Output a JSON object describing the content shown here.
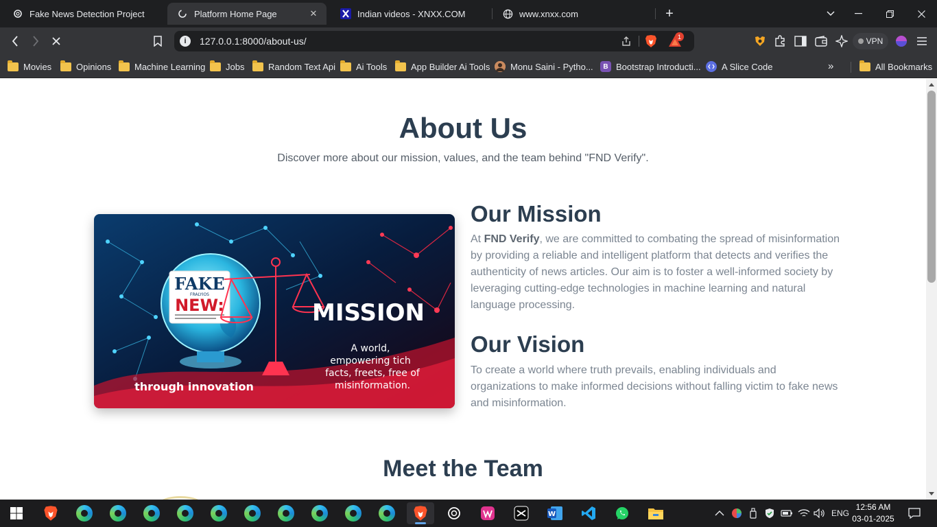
{
  "browser": {
    "tabs": [
      {
        "title": "Fake News Detection Project",
        "icon": "chatgpt-icon",
        "active": false
      },
      {
        "title": "Platform Home Page",
        "icon": "loading-icon",
        "active": true
      },
      {
        "title": "Indian videos - XNXX.COM",
        "icon": "x-site-icon",
        "active": false
      },
      {
        "title": "www.xnxx.com",
        "icon": "globe-icon",
        "active": false
      }
    ],
    "new_tab": "+",
    "url": "127.0.0.1:8000/about-us/",
    "rewards_count": "1",
    "vpn_label": "VPN"
  },
  "bookmarks": {
    "items": [
      {
        "label": "Movies",
        "type": "folder"
      },
      {
        "label": "Opinions",
        "type": "folder"
      },
      {
        "label": "Machine Learning",
        "type": "folder"
      },
      {
        "label": "Jobs",
        "type": "folder"
      },
      {
        "label": "Random Text Api",
        "type": "folder"
      },
      {
        "label": "Ai Tools",
        "type": "folder"
      },
      {
        "label": "App Builder Ai Tools",
        "type": "folder"
      },
      {
        "label": "Monu Saini - Pytho...",
        "type": "link",
        "icon": "avatar-icon"
      },
      {
        "label": "Bootstrap Introducti...",
        "type": "link",
        "icon": "bootstrap-icon",
        "icon_text": "B"
      },
      {
        "label": "A Slice Code",
        "type": "link",
        "icon": "code-icon"
      }
    ],
    "more": "»",
    "all_bookmarks": "All Bookmarks"
  },
  "page": {
    "title": "About Us",
    "subtitle": "Discover more about our mission, values, and the team behind \"FND Verify\".",
    "mission_image": {
      "fake_text": "FAKE",
      "small_text": "FRALYIOS",
      "new_text": "NEW:",
      "mission_text": "MISSION",
      "tagline_lines": [
        "A world,",
        "empowering tich",
        "facts, freets, free of",
        "misinformation."
      ],
      "bottom_text": "through innovation"
    },
    "mission": {
      "heading": "Our Mission",
      "lead": "At ",
      "brand": "FND Verify",
      "body": ", we are committed to combating the spread of misinformation by providing a reliable and intelligent platform that detects and verifies the authenticity of news articles. Our aim is to foster a well-informed society by leveraging cutting-edge technologies in machine learning and natural language processing."
    },
    "vision": {
      "heading": "Our Vision",
      "body": "To create a world where truth prevails, enabling individuals and organizations to make informed decisions without falling victim to fake news and misinformation."
    },
    "team_heading": "Meet the Team"
  },
  "taskbar": {
    "apps": [
      "brave-icon",
      "edge-icon",
      "edge-icon",
      "edge-icon",
      "edge-icon",
      "edge-icon",
      "edge-icon",
      "edge-icon",
      "edge-icon",
      "edge-icon",
      "edge-icon",
      "brave-icon",
      "chatgpt-icon",
      "wamp-icon",
      "capcut-icon",
      "word-icon",
      "vscode-icon",
      "whatsapp-icon",
      "file-explorer-icon"
    ],
    "language": "ENG",
    "time": "12:56 AM",
    "date": "03-01-2025"
  }
}
